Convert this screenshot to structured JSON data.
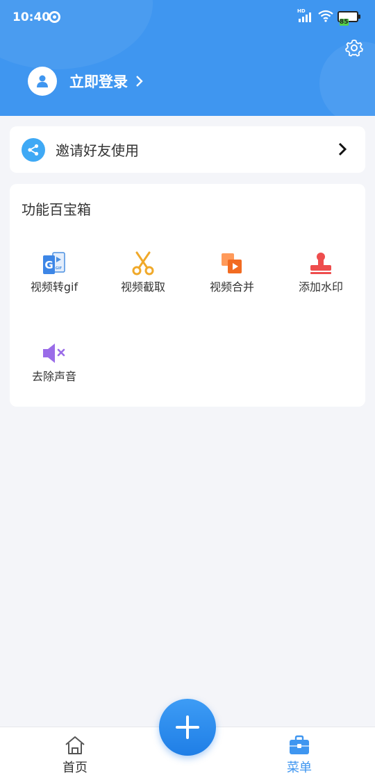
{
  "status_bar": {
    "time": "10:40",
    "network": "HD",
    "battery": "85"
  },
  "header": {
    "login_label": "立即登录"
  },
  "invite": {
    "label": "邀请好友使用"
  },
  "toolbox": {
    "title": "功能百宝箱",
    "tools": [
      {
        "label": "视频转gif",
        "icon": "gif-convert-icon"
      },
      {
        "label": "视频截取",
        "icon": "scissors-icon"
      },
      {
        "label": "视频合并",
        "icon": "merge-icon"
      },
      {
        "label": "添加水印",
        "icon": "stamp-icon"
      },
      {
        "label": "去除声音",
        "icon": "mute-icon"
      }
    ]
  },
  "bottom_nav": {
    "home_label": "首页",
    "menu_label": "菜单"
  },
  "colors": {
    "primary": "#3f96f0",
    "active_tab": "#3f96f0",
    "background": "#f4f5f9"
  }
}
